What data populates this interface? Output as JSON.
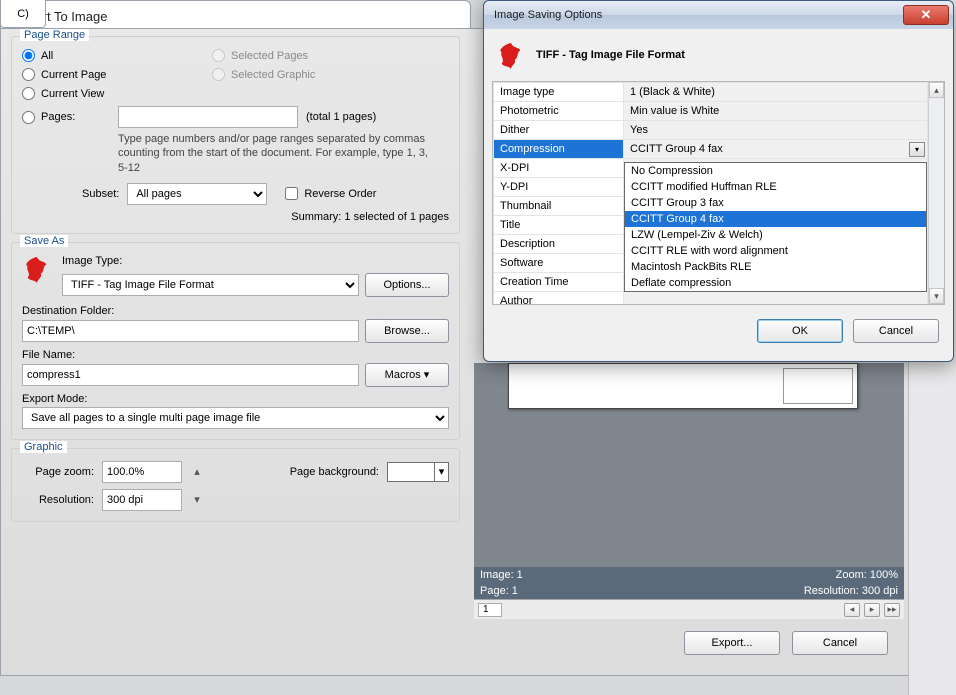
{
  "main_tab": "C)",
  "export": {
    "title": "Export To Image",
    "page_range": {
      "legend": "Page Range",
      "all": "All",
      "current_page": "Current Page",
      "current_view": "Current View",
      "pages": "Pages:",
      "selected_pages": "Selected Pages",
      "selected_graphic": "Selected Graphic",
      "pages_value": "",
      "total_pages": "(total 1 pages)",
      "help": "Type page numbers and/or page ranges separated by commas counting from the start of the document. For example, type 1, 3, 5-12",
      "subset_label": "Subset:",
      "subset_value": "All pages",
      "reverse_order": "Reverse Order",
      "summary": "Summary: 1 selected of 1 pages"
    },
    "save_as": {
      "legend": "Save As",
      "image_type_label": "Image Type:",
      "image_type_value": "TIFF - Tag Image File Format",
      "options_btn": "Options...",
      "dest_folder_label": "Destination Folder:",
      "dest_folder_value": "C:\\TEMP\\",
      "browse_btn": "Browse...",
      "file_name_label": "File Name:",
      "file_name_value": "compress1",
      "macros_btn": "Macros",
      "export_mode_label": "Export Mode:",
      "export_mode_value": "Save all pages to a single multi page image file"
    },
    "graphic": {
      "legend": "Graphic",
      "zoom_label": "Page zoom:",
      "zoom_value": "100.0%",
      "bg_label": "Page background:",
      "resolution_label": "Resolution:",
      "resolution_value": "300 dpi"
    },
    "status": {
      "image": "Image: 1",
      "zoom": "Zoom: 100%",
      "page": "Page: 1",
      "resolution": "Resolution: 300 dpi",
      "page_num": "1"
    },
    "buttons": {
      "export": "Export...",
      "cancel": "Cancel"
    }
  },
  "opts": {
    "window_title": "Image Saving Options",
    "format_title": "TIFF - Tag Image File Format",
    "rows": [
      {
        "k": "Image type",
        "v": "1 (Black & White)"
      },
      {
        "k": "Photometric",
        "v": "Min value is White"
      },
      {
        "k": "Dither",
        "v": "Yes"
      },
      {
        "k": "Compression",
        "v": "CCITT Group 4 fax",
        "selected": true
      },
      {
        "k": "X-DPI",
        "v": ""
      },
      {
        "k": "Y-DPI",
        "v": ""
      },
      {
        "k": "Thumbnail",
        "v": ""
      },
      {
        "k": "Title",
        "v": ""
      },
      {
        "k": "Description",
        "v": ""
      },
      {
        "k": "Software",
        "v": ""
      },
      {
        "k": "Creation Time",
        "v": ""
      },
      {
        "k": "Author",
        "v": ""
      }
    ],
    "dropdown": {
      "items": [
        "No Compression",
        "CCITT modified Huffman RLE",
        "CCITT Group 3 fax",
        "CCITT Group 4 fax",
        "LZW (Lempel-Ziv & Welch)",
        "CCITT RLE with word alignment",
        "Macintosh PackBits RLE",
        "Deflate compression"
      ],
      "highlighted": "CCITT Group 4 fax"
    },
    "ok": "OK",
    "cancel": "Cancel"
  }
}
